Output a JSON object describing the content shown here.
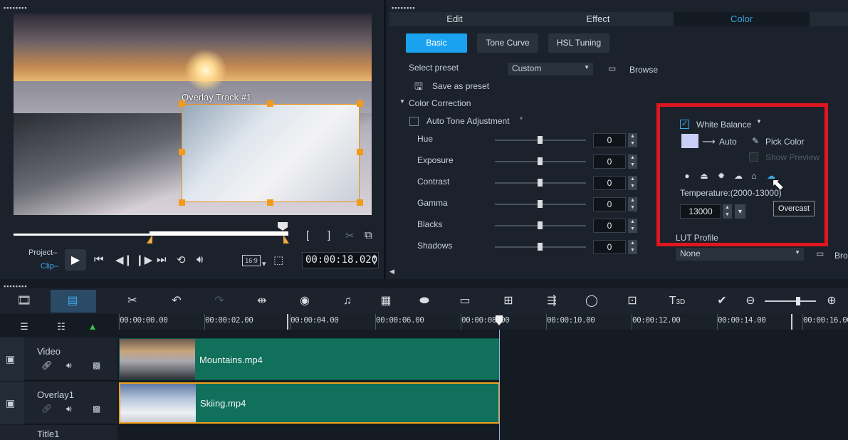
{
  "player": {
    "overlay_label": "Overlay Track #1",
    "mode_project": "Project",
    "mode_clip": "Clip",
    "aspect": "16:9",
    "timecode": "00:00:18.020",
    "bracket_in": "[",
    "bracket_out": "]"
  },
  "tabs": [
    {
      "label": "Edit"
    },
    {
      "label": "Effect"
    },
    {
      "label": "Color"
    }
  ],
  "color": {
    "sub_tabs": [
      "Basic",
      "Tone Curve",
      "HSL Tuning"
    ],
    "select_preset_label": "Select preset",
    "preset_value": "Custom",
    "browse_label": "Browse",
    "save_preset_label": "Save as preset",
    "section_label": "Color Correction",
    "auto_tone_label": "Auto Tone Adjustment",
    "sliders": [
      {
        "label": "Hue",
        "value": "0"
      },
      {
        "label": "Exposure",
        "value": "0"
      },
      {
        "label": "Contrast",
        "value": "0"
      },
      {
        "label": "Gamma",
        "value": "0"
      },
      {
        "label": "Blacks",
        "value": "0"
      },
      {
        "label": "Shadows",
        "value": "0"
      }
    ],
    "white_balance_label": "White Balance",
    "auto_label": "Auto",
    "pick_color_label": "Pick Color",
    "show_preview_label": "Show Preview",
    "temperature_label": "Temperature:(2000-13000)",
    "temperature_value": "13000",
    "tooltip": "Overcast",
    "lut_label": "LUT Profile",
    "lut_value": "None",
    "lut_browse": "Bro"
  },
  "ruler": [
    "00:00:00.00",
    "00:00:02.00",
    "00:00:04.00",
    "00:00:06.00",
    "00:00:08.00",
    "00:00:10.00",
    "00:00:12.00",
    "00:00:14.00",
    "00:00:16.00"
  ],
  "tracks": [
    {
      "name": "Video",
      "clip": "Mountains.mp4"
    },
    {
      "name": "Overlay1",
      "clip": "Skiing.mp4"
    },
    {
      "name": "Title1"
    }
  ],
  "toolbar_text": {
    "t3d": "T",
    "t3d_sub": "3D"
  }
}
